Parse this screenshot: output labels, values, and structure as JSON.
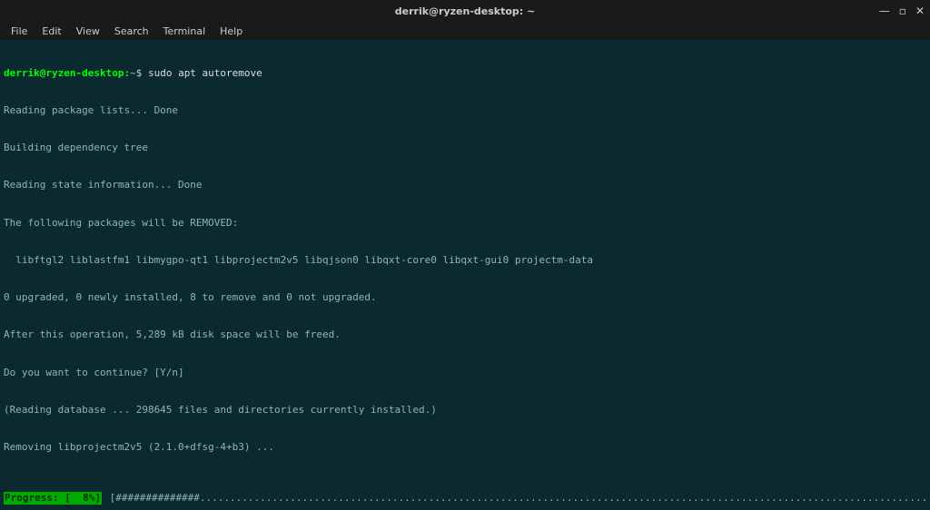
{
  "titlebar": {
    "title": "derrik@ryzen-desktop: ~"
  },
  "menubar": {
    "items": [
      "File",
      "Edit",
      "View",
      "Search",
      "Terminal",
      "Help"
    ]
  },
  "prompt": {
    "user_host": "derrik@ryzen-desktop",
    "path": "~",
    "dollar": "$",
    "command": "sudo apt autoremove"
  },
  "output": {
    "l0": "Reading package lists... Done",
    "l1": "Building dependency tree",
    "l2": "Reading state information... Done",
    "l3": "The following packages will be REMOVED:",
    "l4": "  libftgl2 liblastfm1 libmygpo-qt1 libprojectm2v5 libqjson0 libqxt-core0 libqxt-gui0 projectm-data",
    "l5": "0 upgraded, 0 newly installed, 8 to remove and 0 not upgraded.",
    "l6": "After this operation, 5,289 kB disk space will be freed.",
    "l7": "Do you want to continue? [Y/n]",
    "l8": "(Reading database ... 298645 files and directories currently installed.)",
    "l9": "Removing libprojectm2v5 (2.1.0+dfsg-4+b3) ..."
  },
  "progress": {
    "label": "Progress: [  8%]",
    "bar": " [##############...........................................................................................................................................................................]"
  }
}
